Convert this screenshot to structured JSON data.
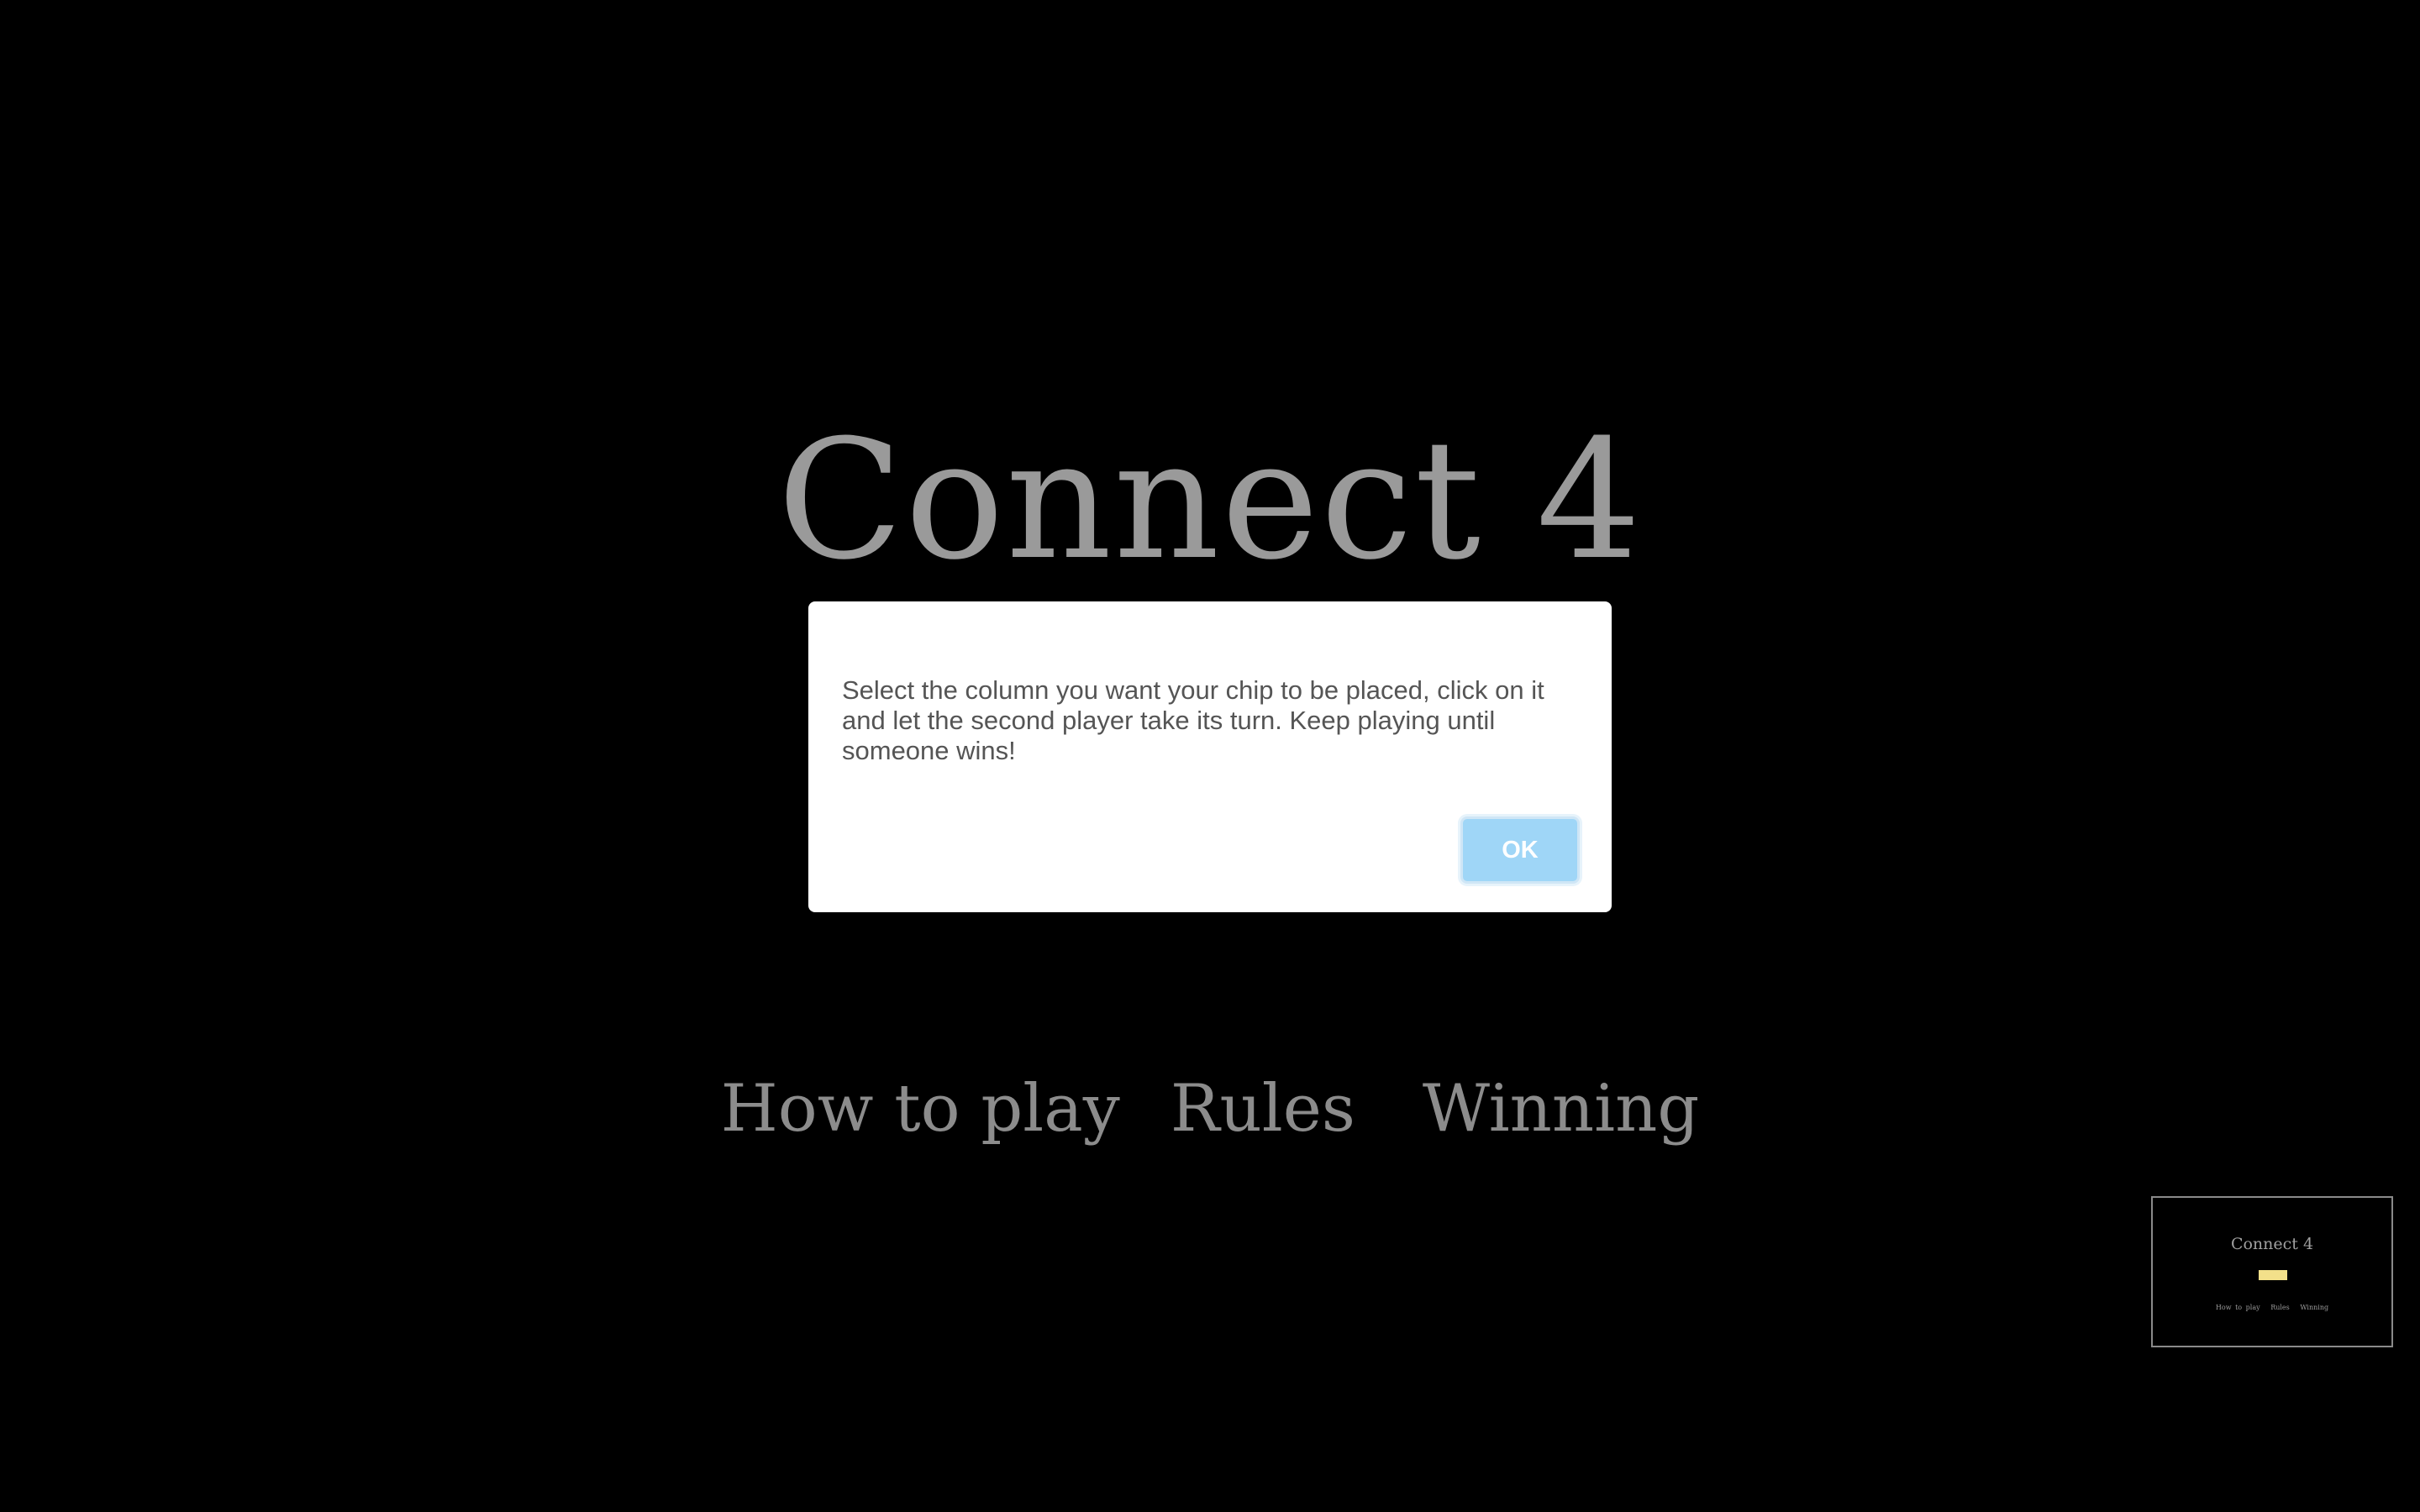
{
  "game": {
    "title": "Connect 4",
    "nav": {
      "how_to_play": "How to play",
      "rules": "Rules",
      "winning": "Winning"
    }
  },
  "dialog": {
    "message": "Select the column you want your chip to be placed, click on it and let the second player take its turn. Keep playing until someone wins!",
    "ok_label": "OK"
  },
  "preview": {
    "title": "Connect 4",
    "nav": {
      "how_to_play": "How to play",
      "rules": "Rules",
      "winning": "Winning"
    },
    "chip_color": "#f3e08a"
  },
  "colors": {
    "background": "#000000",
    "title_text": "#9a9a9a",
    "button_bg": "#9fd6f7",
    "dialog_bg": "#ffffff"
  }
}
